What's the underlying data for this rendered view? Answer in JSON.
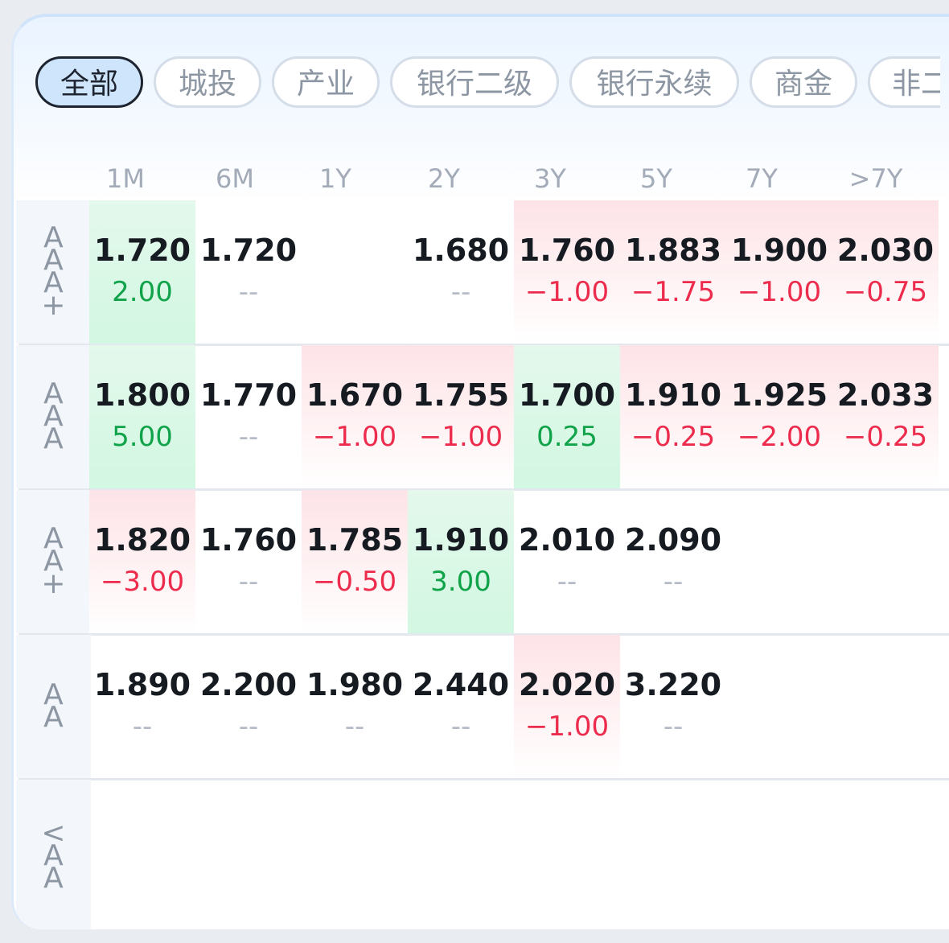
{
  "tabs": [
    "全部",
    "城投",
    "产业",
    "银行二级",
    "银行永续",
    "商金",
    "非二"
  ],
  "columns": [
    "1M",
    "6M",
    "1Y",
    "2Y",
    "3Y",
    "5Y",
    "7Y",
    ">7Y"
  ],
  "colors": {
    "up": "#ec2b4d",
    "down": "#10a34a",
    "neutral": "#b4bbc6",
    "active_tab_bg": "#cfe5fb"
  },
  "rows": [
    {
      "label": "AAA+",
      "cells": [
        {
          "value": "1.720",
          "change": "2.00",
          "trend": "down"
        },
        {
          "value": "1.720",
          "change": "--",
          "trend": "none"
        },
        {
          "value": "",
          "change": "",
          "trend": "none"
        },
        {
          "value": "1.680",
          "change": "--",
          "trend": "none"
        },
        {
          "value": "1.760",
          "change": "-1.00",
          "trend": "up"
        },
        {
          "value": "1.883",
          "change": "-1.75",
          "trend": "up"
        },
        {
          "value": "1.900",
          "change": "-1.00",
          "trend": "up"
        },
        {
          "value": "2.030",
          "change": "-0.75",
          "trend": "up"
        }
      ]
    },
    {
      "label": "AAA",
      "cells": [
        {
          "value": "1.800",
          "change": "5.00",
          "trend": "down"
        },
        {
          "value": "1.770",
          "change": "--",
          "trend": "none"
        },
        {
          "value": "1.670",
          "change": "-1.00",
          "trend": "up"
        },
        {
          "value": "1.755",
          "change": "-1.00",
          "trend": "up"
        },
        {
          "value": "1.700",
          "change": "0.25",
          "trend": "down"
        },
        {
          "value": "1.910",
          "change": "-0.25",
          "trend": "up"
        },
        {
          "value": "1.925",
          "change": "-2.00",
          "trend": "up"
        },
        {
          "value": "2.033",
          "change": "-0.25",
          "trend": "up"
        }
      ]
    },
    {
      "label": "AA+",
      "cells": [
        {
          "value": "1.820",
          "change": "-3.00",
          "trend": "up"
        },
        {
          "value": "1.760",
          "change": "--",
          "trend": "none"
        },
        {
          "value": "1.785",
          "change": "-0.50",
          "trend": "up"
        },
        {
          "value": "1.910",
          "change": "3.00",
          "trend": "down"
        },
        {
          "value": "2.010",
          "change": "--",
          "trend": "none"
        },
        {
          "value": "2.090",
          "change": "--",
          "trend": "none"
        },
        {
          "value": "",
          "change": "",
          "trend": "none"
        },
        {
          "value": "",
          "change": "",
          "trend": "none"
        }
      ]
    },
    {
      "label": "AA",
      "cells": [
        {
          "value": "1.890",
          "change": "--",
          "trend": "none"
        },
        {
          "value": "2.200",
          "change": "--",
          "trend": "none"
        },
        {
          "value": "1.980",
          "change": "--",
          "trend": "none"
        },
        {
          "value": "2.440",
          "change": "--",
          "trend": "none"
        },
        {
          "value": "2.020",
          "change": "-1.00",
          "trend": "up"
        },
        {
          "value": "3.220",
          "change": "--",
          "trend": "none"
        },
        {
          "value": "",
          "change": "",
          "trend": "none"
        },
        {
          "value": "",
          "change": "",
          "trend": "none"
        }
      ]
    },
    {
      "label": "<AA",
      "cells": [
        {
          "value": "",
          "change": "",
          "trend": "none"
        },
        {
          "value": "",
          "change": "",
          "trend": "none"
        },
        {
          "value": "",
          "change": "",
          "trend": "none"
        },
        {
          "value": "",
          "change": "",
          "trend": "none"
        },
        {
          "value": "",
          "change": "",
          "trend": "none"
        },
        {
          "value": "",
          "change": "",
          "trend": "none"
        },
        {
          "value": "",
          "change": "",
          "trend": "none"
        },
        {
          "value": "",
          "change": "",
          "trend": "none"
        }
      ]
    }
  ]
}
